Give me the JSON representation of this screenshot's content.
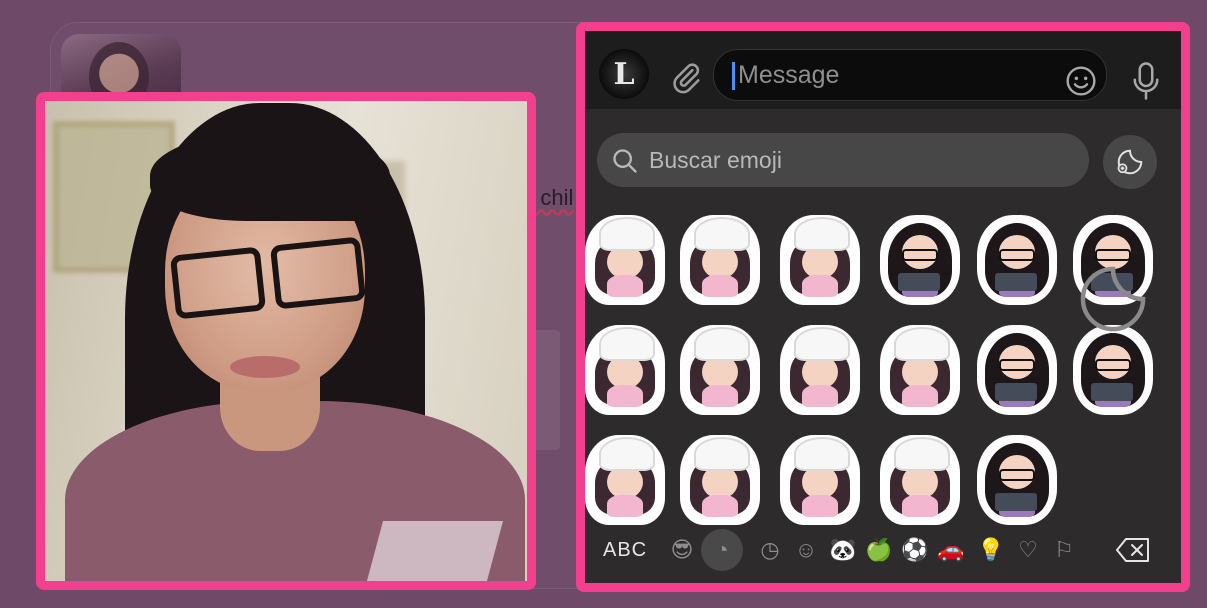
{
  "message_bar": {
    "placeholder": "Message",
    "avatar_letter": "L"
  },
  "emoji_search": {
    "placeholder": "Buscar emoji"
  },
  "background": {
    "partial_text": "e chil"
  },
  "keyboard": {
    "abc_label": "ABC",
    "categories": [
      "smileys",
      "stickers",
      "recent",
      "emoji",
      "animals",
      "food",
      "activity",
      "travel",
      "objects",
      "symbols",
      "flags"
    ],
    "active_category": "stickers"
  },
  "stickers": [
    {
      "kind": "chef"
    },
    {
      "kind": "chef"
    },
    {
      "kind": "chef"
    },
    {
      "kind": "gamer"
    },
    {
      "kind": "gamer"
    },
    {
      "kind": "gamer"
    },
    {
      "kind": "chef"
    },
    {
      "kind": "chef"
    },
    {
      "kind": "chef"
    },
    {
      "kind": "chef"
    },
    {
      "kind": "gamer"
    },
    {
      "kind": "gamer"
    },
    {
      "kind": "chef"
    },
    {
      "kind": "chef"
    },
    {
      "kind": "chef"
    },
    {
      "kind": "chef"
    },
    {
      "kind": "gamer"
    }
  ],
  "colors": {
    "highlight_border": "#f43f8e",
    "background": "#6e4a68",
    "keyboard_bg": "#2d2b2c",
    "caret": "#4c8ff5"
  }
}
